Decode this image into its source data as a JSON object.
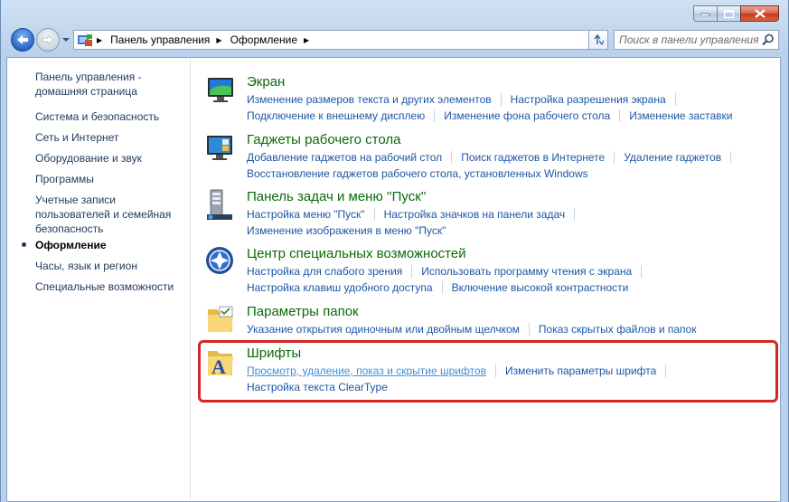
{
  "window": {
    "caption": {
      "minimize": "minimize",
      "maximize": "maximize",
      "close": "close"
    }
  },
  "nav": {
    "breadcrumbs": [
      "Панель управления",
      "Оформление"
    ],
    "search_placeholder": "Поиск в панели управления"
  },
  "sidebar": {
    "items": [
      {
        "label": "Панель управления - домашняя страница",
        "current": false
      },
      {
        "label": "Система и безопасность",
        "current": false
      },
      {
        "label": "Сеть и Интернет",
        "current": false
      },
      {
        "label": "Оборудование и звук",
        "current": false
      },
      {
        "label": "Программы",
        "current": false
      },
      {
        "label": "Учетные записи пользователей и семейная безопасность",
        "current": false
      },
      {
        "label": "Оформление",
        "current": true
      },
      {
        "label": "Часы, язык и регион",
        "current": false
      },
      {
        "label": "Специальные возможности",
        "current": false
      }
    ]
  },
  "categories": [
    {
      "title": "Экран",
      "icon": "display-icon",
      "rows": [
        [
          "Изменение размеров текста и других элементов",
          "Настройка разрешения экрана"
        ],
        [
          "Подключение к внешнему дисплею",
          "Изменение фона рабочего стола",
          "Изменение заставки"
        ]
      ]
    },
    {
      "title": "Гаджеты рабочего стола",
      "icon": "gadgets-icon",
      "rows": [
        [
          "Добавление гаджетов на рабочий стол",
          "Поиск гаджетов в Интернете",
          "Удаление гаджетов"
        ],
        [
          "Восстановление гаджетов рабочего стола, установленных Windows"
        ]
      ]
    },
    {
      "title": "Панель задач и меню ''Пуск''",
      "icon": "taskbar-icon",
      "rows": [
        [
          "Настройка меню \"Пуск\"",
          "Настройка значков на панели задач"
        ],
        [
          "Изменение изображения в меню \"Пуск\""
        ]
      ]
    },
    {
      "title": "Центр специальных возможностей",
      "icon": "accessibility-icon",
      "rows": [
        [
          "Настройка для слабого зрения",
          "Использовать программу чтения с экрана"
        ],
        [
          "Настройка клавиш удобного доступа",
          "Включение высокой контрастности"
        ]
      ]
    },
    {
      "title": "Параметры папок",
      "icon": "folder-options-icon",
      "rows": [
        [
          "Указание открытия одиночным или двойным щелчком",
          "Показ скрытых файлов и папок"
        ]
      ]
    },
    {
      "title": "Шрифты",
      "icon": "fonts-icon",
      "rows": [
        [
          "Просмотр, удаление, показ и скрытие шрифтов",
          "Изменить параметры шрифта"
        ],
        [
          "Настройка текста ClearType"
        ]
      ]
    }
  ],
  "colors": {
    "category_title": "#0b6a0b",
    "link": "#1c57a5",
    "highlight_border": "#d42626"
  }
}
